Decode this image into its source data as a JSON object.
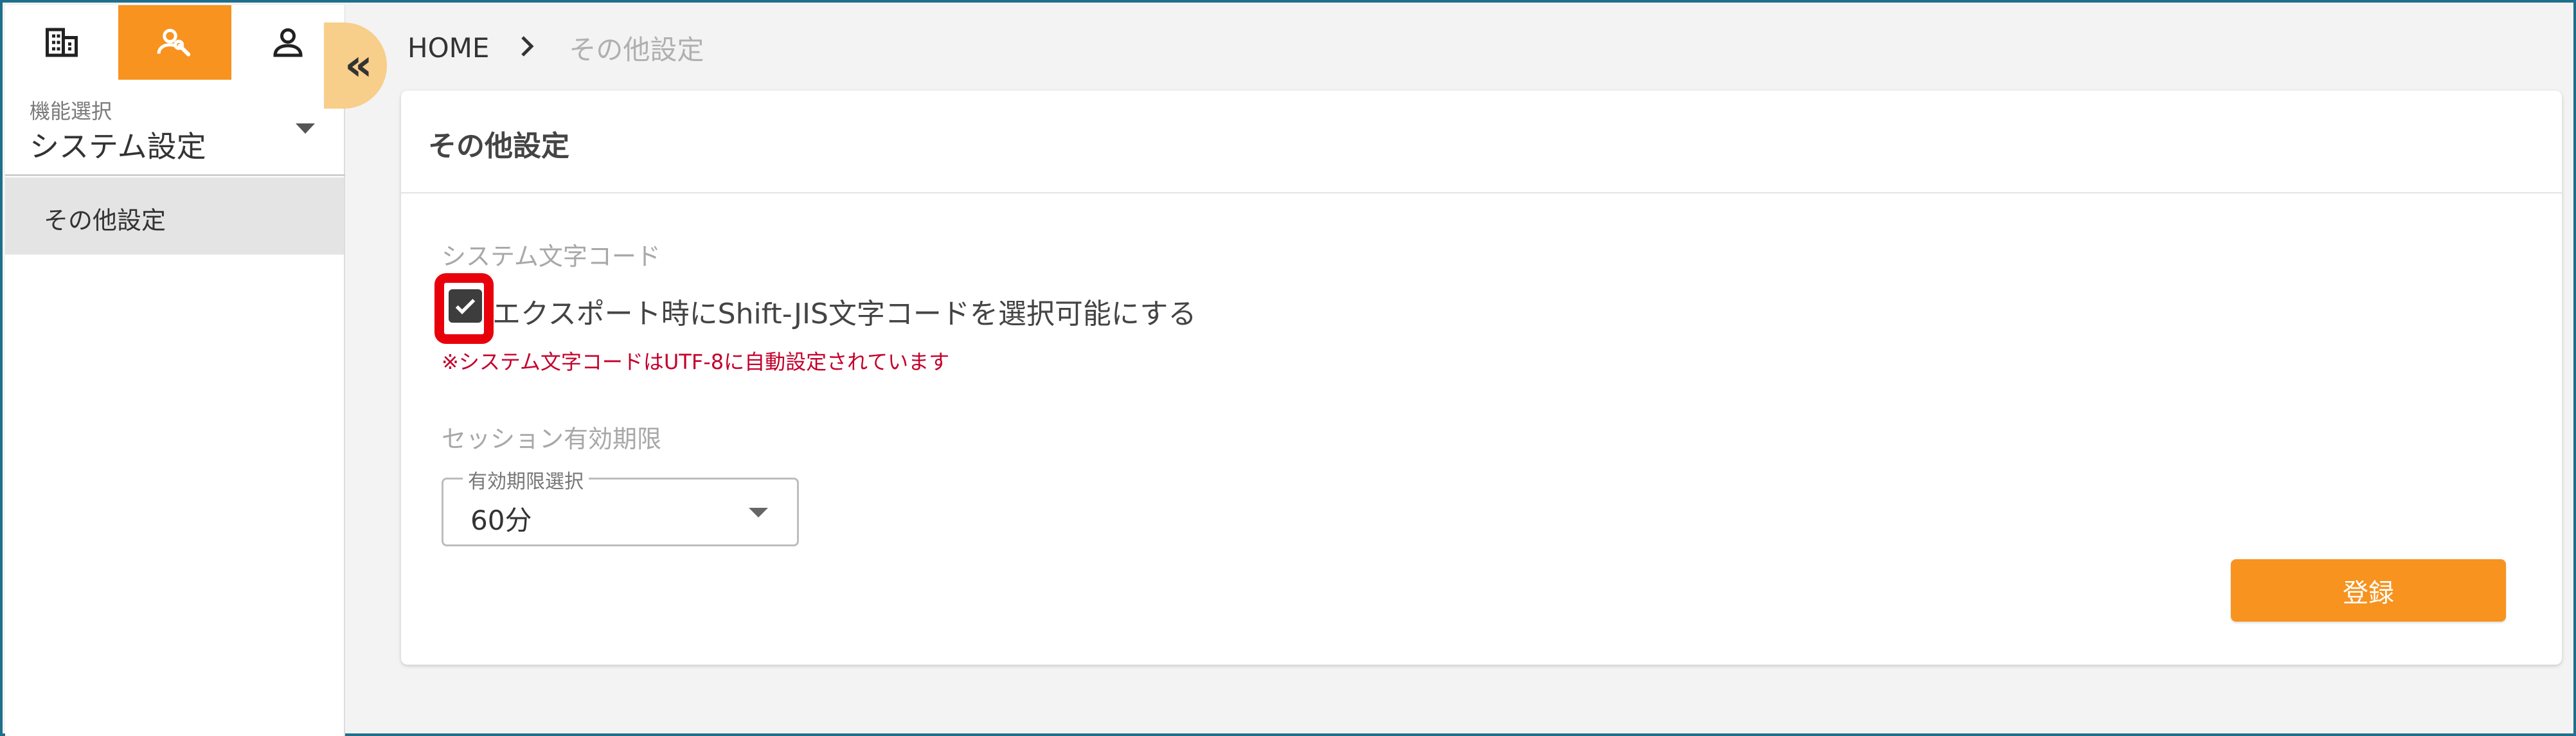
{
  "sidebar": {
    "tabs": [
      {
        "icon": "building-icon",
        "active": false
      },
      {
        "icon": "user-settings-icon",
        "active": true
      },
      {
        "icon": "person-icon",
        "active": false
      }
    ],
    "function_select": {
      "label": "機能選択",
      "value": "システム設定"
    },
    "menu_items": [
      {
        "label": "その他設定"
      }
    ],
    "collapse_icon": "double-chevron-left-icon"
  },
  "breadcrumb": {
    "home": "HOME",
    "separator_icon": "chevron-right-icon",
    "current": "その他設定"
  },
  "card": {
    "title": "その他設定",
    "system_charcode": {
      "label": "システム文字コード",
      "checkbox_label": "エクスポート時にShift-JIS文字コードを選択可能にする",
      "checked": true,
      "note": "※システム文字コードはUTF-8に自動設定されています"
    },
    "session": {
      "label": "セッション有効期限",
      "select_label": "有効期限選択",
      "select_value": "60分"
    },
    "submit_label": "登録"
  },
  "colors": {
    "accent": "#f7931e",
    "highlight": "#e8000b",
    "note": "#c4002b",
    "collapse_bg": "#f7ce8a"
  }
}
